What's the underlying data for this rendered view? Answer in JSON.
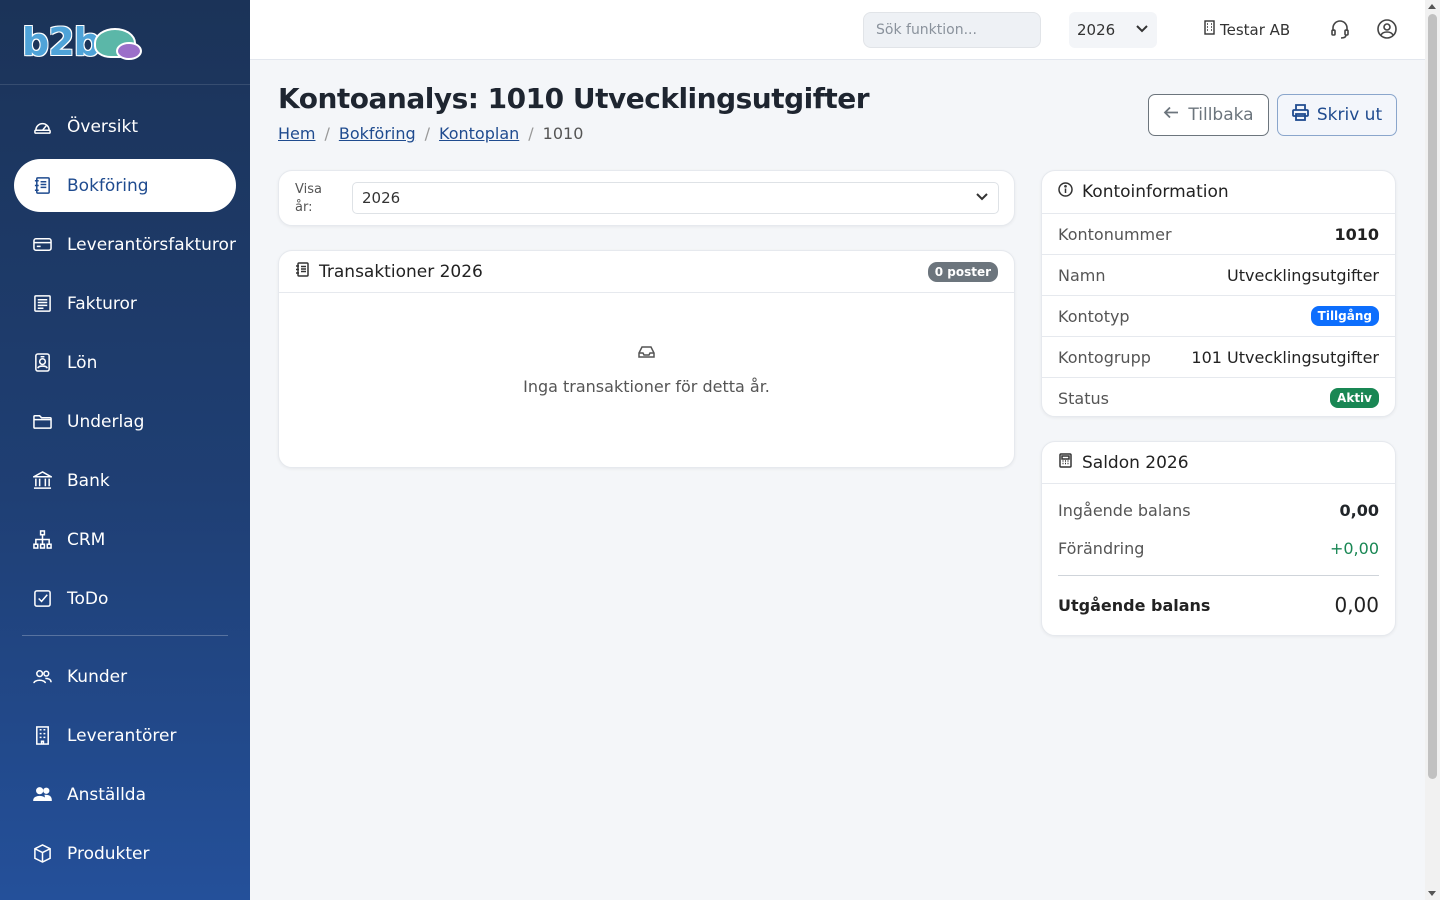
{
  "sidebar": {
    "logo": "b2b",
    "items": [
      {
        "label": "Översikt",
        "icon": "gauge-icon"
      },
      {
        "label": "Bokföring",
        "icon": "journal-icon",
        "active": true
      },
      {
        "label": "Leverantörsfakturor",
        "icon": "credit-card-icon"
      },
      {
        "label": "Fakturor",
        "icon": "invoice-icon"
      },
      {
        "label": "Lön",
        "icon": "person-badge-icon"
      },
      {
        "label": "Underlag",
        "icon": "folder-icon"
      },
      {
        "label": "Bank",
        "icon": "bank-icon"
      },
      {
        "label": "CRM",
        "icon": "org-chart-icon"
      },
      {
        "label": "ToDo",
        "icon": "check-square-icon"
      }
    ],
    "items2": [
      {
        "label": "Kunder",
        "icon": "people-icon"
      },
      {
        "label": "Leverantörer",
        "icon": "building-icon"
      },
      {
        "label": "Anställda",
        "icon": "people-fill-icon"
      },
      {
        "label": "Produkter",
        "icon": "box-icon"
      }
    ]
  },
  "topbar": {
    "search_placeholder": "Sök funktion...",
    "year": "2026",
    "company": "Testar AB"
  },
  "page": {
    "title": "Kontoanalys: 1010 Utvecklingsutgifter",
    "breadcrumb": [
      "Hem",
      "Bokföring",
      "Kontoplan",
      "1010"
    ],
    "back_label": "Tillbaka",
    "print_label": "Skriv ut"
  },
  "filter": {
    "label": "Visa år:",
    "year": "2026"
  },
  "transactions": {
    "title": "Transaktioner 2026",
    "count_badge": "0 poster",
    "empty_text": "Inga transaktioner för detta år."
  },
  "account_info": {
    "title": "Kontoinformation",
    "rows": [
      {
        "label": "Kontonummer",
        "value": "1010"
      },
      {
        "label": "Namn",
        "value": "Utvecklingsutgifter"
      },
      {
        "label": "Kontotyp",
        "value": "Tillgång"
      },
      {
        "label": "Kontogrupp",
        "value": "101 Utvecklingsutgifter"
      },
      {
        "label": "Status",
        "value": "Aktiv"
      }
    ]
  },
  "balances": {
    "title": "Saldon 2026",
    "opening_label": "Ingående balans",
    "opening_value": "0,00",
    "change_label": "Förändring",
    "change_value": "+0,00",
    "closing_label": "Utgående balans",
    "closing_value": "0,00"
  },
  "colors": {
    "sidebar_top": "#1b3358",
    "sidebar_bottom": "#24509a",
    "accent": "#1f4b8f",
    "badge_blue": "#0d6efd",
    "badge_green": "#198754",
    "positive": "#198754"
  }
}
